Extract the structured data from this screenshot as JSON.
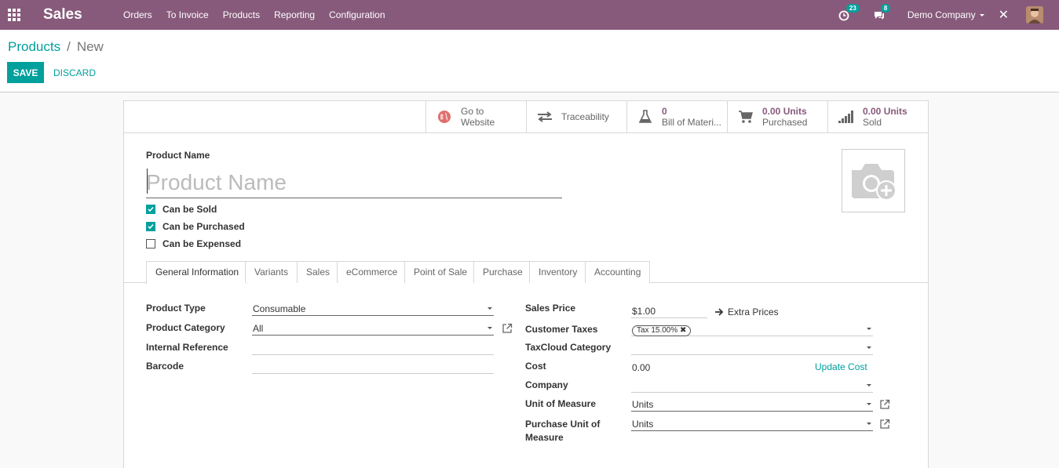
{
  "navbar": {
    "app_name": "Sales",
    "menu": [
      "Orders",
      "To Invoice",
      "Products",
      "Reporting",
      "Configuration"
    ],
    "activity_count": "23",
    "message_count": "8",
    "company": "Demo Company",
    "close_glyph": "✕"
  },
  "control": {
    "breadcrumb_parent": "Products",
    "breadcrumb_sep": "/",
    "breadcrumb_current": "New",
    "save_label": "SAVE",
    "discard_label": "DISCARD"
  },
  "smart_buttons": {
    "website": {
      "line1": "Go to",
      "line2": "Website"
    },
    "traceability": {
      "label": "Traceability"
    },
    "bom": {
      "value": "0",
      "label": "Bill of Materi..."
    },
    "purchased": {
      "value": "0.00 Units",
      "label": "Purchased"
    },
    "sold": {
      "value": "0.00 Units",
      "label": "Sold"
    }
  },
  "product": {
    "name_label": "Product Name",
    "name_placeholder": "Product Name",
    "can_be_sold": "Can be Sold",
    "can_be_purchased": "Can be Purchased",
    "can_be_expensed": "Can be Expensed"
  },
  "tabs": [
    "General Information",
    "Variants",
    "Sales",
    "eCommerce",
    "Point of Sale",
    "Purchase",
    "Inventory",
    "Accounting"
  ],
  "general": {
    "product_type_label": "Product Type",
    "product_type_value": "Consumable",
    "product_category_label": "Product Category",
    "product_category_value": "All",
    "internal_reference_label": "Internal Reference",
    "barcode_label": "Barcode",
    "sales_price_label": "Sales Price",
    "sales_price_value": "$1.00",
    "extra_prices": "Extra Prices",
    "customer_taxes_label": "Customer Taxes",
    "customer_taxes_tag": "Tax 15.00%",
    "taxcloud_label": "TaxCloud Category",
    "cost_label": "Cost",
    "cost_value": "0.00",
    "update_cost": "Update Cost",
    "company_label": "Company",
    "uom_label": "Unit of Measure",
    "uom_value": "Units",
    "purchase_uom_label_1": "Purchase Unit of",
    "purchase_uom_label_2": "Measure",
    "purchase_uom_value": "Units"
  },
  "colors": {
    "navbar": "#875a7b",
    "accent": "#00a09d",
    "stat_value": "#875a7b"
  }
}
